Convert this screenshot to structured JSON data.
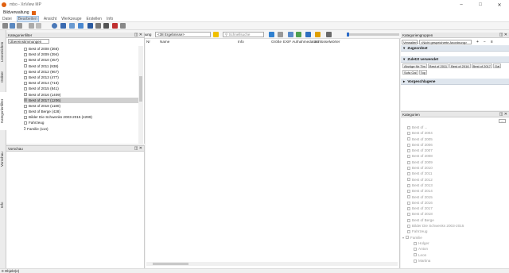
{
  "window": {
    "title": "mbo - XnView MP",
    "sub_label": "Bildverwaltung"
  },
  "menu": [
    "Datei",
    "Bearbeiten",
    "Ansicht",
    "Werkzeuge",
    "Erstellen",
    "Info"
  ],
  "toolbar2": {
    "arrangement_label": "Anordnung",
    "results_combo": "<38 Ergebnisse>",
    "search_placeholder": "Schnellsuche"
  },
  "left_panel": {
    "title": "Kategorienfilter",
    "combo": "Übereinstimmungen",
    "items": [
      {
        "label": "Best of 2008 (366)",
        "selected": false
      },
      {
        "label": "Best of 2009 (394)",
        "selected": false
      },
      {
        "label": "Best of 2010 (457)",
        "selected": false
      },
      {
        "label": "Best of 2011 (938)",
        "selected": false
      },
      {
        "label": "Best of 2012 (967)",
        "selected": false
      },
      {
        "label": "Best of 2013 (477)",
        "selected": false
      },
      {
        "label": "Best of 2014 (716)",
        "selected": false
      },
      {
        "label": "Best of 2015 (841)",
        "selected": false
      },
      {
        "label": "Best of 2016 (1409)",
        "selected": false
      },
      {
        "label": "Best of 2017 (1206)",
        "selected": true
      },
      {
        "label": "Best of 2018 (1180)",
        "selected": false
      },
      {
        "label": "Best of Berge (428)",
        "selected": false
      },
      {
        "label": "Bilder Die Schwenks 2003-2015 (4299)",
        "selected": false
      },
      {
        "label": "Fahrzeug",
        "selected": false
      },
      {
        "label": "Familie (114)",
        "selected": false
      }
    ],
    "tabs": [
      "Lesezeichen",
      "Ordner",
      "Kategorienfilter"
    ]
  },
  "preview_panel": {
    "title": "Vorschau",
    "tab": "Info"
  },
  "center": {
    "columns": [
      "Nr",
      "Name",
      "Info",
      "Größe",
      "EXIF Aufnahmedatum",
      "Schlüsselwörter"
    ]
  },
  "right_top": {
    "title": "Kategoriengruppen",
    "combo1": "Verwalten...",
    "combo2": "<Nicht gespeicherte Anordnung>",
    "sections": [
      {
        "label": "Zugeordnet",
        "expanded": true
      },
      {
        "label": "Zuletzt verwendet",
        "expanded": true
      },
      {
        "label": "Vorgeschlagene",
        "expanded": false
      }
    ],
    "recent_tags": [
      "Abzüge für Tim",
      "Best of 2011",
      "Best of 2016",
      "Best of 2017",
      "Gal",
      "Sofa Gal",
      "Top"
    ]
  },
  "right_bottom": {
    "title": "Kategorien",
    "items": [
      "Best of ...",
      "Best of 2004",
      "Best of 2005",
      "Best of 2006",
      "Best of 2007",
      "Best of 2008",
      "Best of 2009",
      "Best of 2010",
      "Best of 2011",
      "Best of 2012",
      "Best of 2013",
      "Best of 2014",
      "Best of 2015",
      "Best of 2016",
      "Best of 2017",
      "Best of 2018",
      "Best of Berge",
      "Bilder Die Schwenks 2003-2015",
      "Fahrzeug",
      "Familie",
      "Holger",
      "Anton",
      "Leon",
      "Martina"
    ]
  },
  "status": {
    "text": "0 Objekt(e)"
  }
}
